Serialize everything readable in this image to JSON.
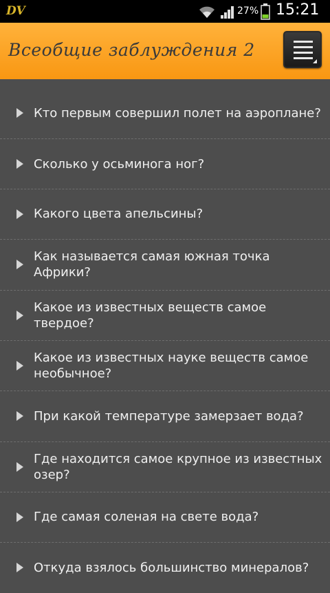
{
  "status_bar": {
    "battery_percent": "27%",
    "time": "15:21",
    "app_icon": "DV",
    "icons": [
      "wifi-icon",
      "signal-icon",
      "battery-icon"
    ]
  },
  "app_bar": {
    "title": "Всеобщие заблуждения 2",
    "menu_icon": "menu-icon",
    "accent_color": "#f99712"
  },
  "questions": [
    {
      "text": "Кто первым совершил полет на аэроплане?"
    },
    {
      "text": "Сколько у осьминога ног?"
    },
    {
      "text": "Какого цвета апельсины?"
    },
    {
      "text": "Как называется самая южная точка Африки?"
    },
    {
      "text": "Какое из известных веществ самое твердое?"
    },
    {
      "text": "Какое из известных науке веществ самое необычное?"
    },
    {
      "text": "При какой температуре замерзает вода?"
    },
    {
      "text": "Где находится самое крупное из известных озер?"
    },
    {
      "text": "Где самая соленая на свете вода?"
    },
    {
      "text": "Откуда взялось большинство минералов?"
    }
  ]
}
